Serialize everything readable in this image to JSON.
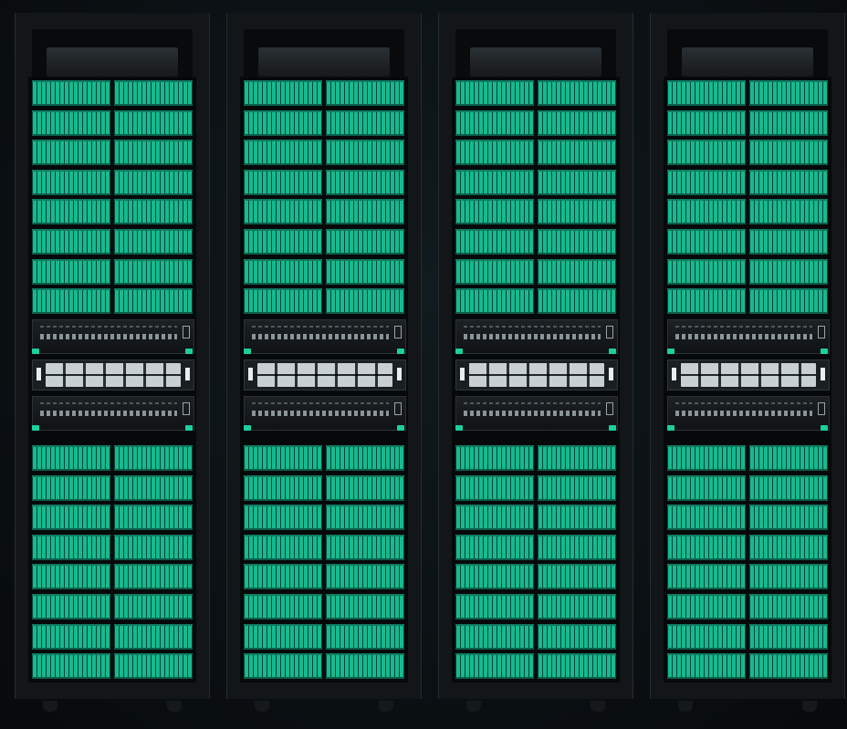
{
  "scene": {
    "description_free": true,
    "colors": {
      "background": "#0b1013",
      "rack_frame": "#121618",
      "drive_green": "#17b98f",
      "drive_green_dark": "#0f7c61",
      "server_silver": "#c9d0d3",
      "switch_dark": "#1c2124"
    },
    "racks": [
      {
        "id": "rack-1",
        "drive_shelves_upper": 8,
        "drive_shelves_lower": 8,
        "switches": 2,
        "servers": 1
      },
      {
        "id": "rack-2",
        "drive_shelves_upper": 8,
        "drive_shelves_lower": 8,
        "switches": 2,
        "servers": 1
      },
      {
        "id": "rack-3",
        "drive_shelves_upper": 8,
        "drive_shelves_lower": 8,
        "switches": 2,
        "servers": 1
      },
      {
        "id": "rack-4",
        "drive_shelves_upper": 8,
        "drive_shelves_lower": 8,
        "switches": 2,
        "servers": 1
      }
    ]
  }
}
